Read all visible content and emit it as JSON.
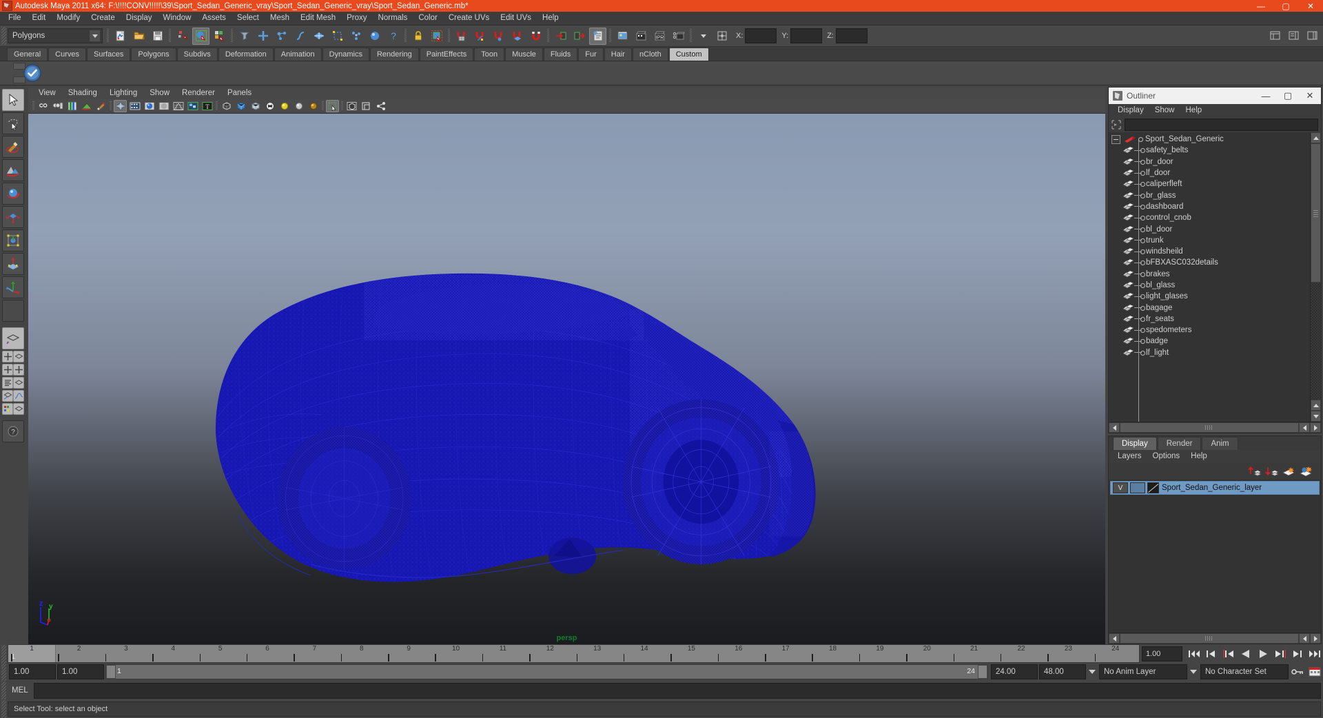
{
  "window": {
    "title": "Autodesk Maya 2011 x64: F:\\!!!!CONV!!!!!\\39\\Sport_Sedan_Generic_vray\\Sport_Sedan_Generic_vray\\Sport_Sedan_Generic.mb*",
    "minimize": "—",
    "maximize": "▢",
    "close": "✕",
    "accent_color": "#e8491d"
  },
  "menubar": {
    "items": [
      "File",
      "Edit",
      "Modify",
      "Create",
      "Display",
      "Window",
      "Assets",
      "Select",
      "Mesh",
      "Edit Mesh",
      "Proxy",
      "Normals",
      "Color",
      "Create UVs",
      "Edit UVs",
      "Help"
    ]
  },
  "statusline": {
    "menu_set": "Polygons",
    "coord_labels": {
      "x": "X:",
      "y": "Y:",
      "z": "Z:"
    },
    "coord_values": {
      "x": "",
      "y": "",
      "z": ""
    },
    "icons": [
      "new-scene-icon",
      "open-scene-icon",
      "save-scene-icon",
      "select-by-hierarchy-icon",
      "select-by-object-icon",
      "select-by-component-icon",
      "mask-filter-icon",
      "select-handles-icon",
      "select-joints-icon",
      "select-curves-icon",
      "select-surfaces-icon",
      "select-deformations-icon",
      "select-dynamics-icon",
      "select-rendering-icon",
      "select-misc-icon",
      "lock-icon",
      "marquee-select-icon",
      "snap-grid-icon",
      "snap-curve-icon",
      "snap-point-icon",
      "snap-view-plane-icon",
      "snap-magnet-icon",
      "input-connections-icon",
      "output-connections-icon",
      "attribute-editor-icon",
      "render-view-icon",
      "render-current-frame-icon",
      "ipr-render-icon",
      "render-settings-icon",
      "channel-box-toggle-icon"
    ]
  },
  "shelf": {
    "tabs": [
      "General",
      "Curves",
      "Surfaces",
      "Polygons",
      "Subdivs",
      "Deformation",
      "Animation",
      "Dynamics",
      "Rendering",
      "PaintEffects",
      "Toon",
      "Muscle",
      "Fluids",
      "Fur",
      "Hair",
      "nCloth",
      "Custom"
    ],
    "active_tab": "Custom",
    "items": [
      "vray-render-icon"
    ]
  },
  "toolbox": {
    "tools": [
      "select-tool",
      "lasso-select-tool",
      "paint-select-tool",
      "sculpt-geometry-tool",
      "rotate-tool",
      "scale-tool",
      "universal-manipulator-tool",
      "soft-modification-tool",
      "move-tool",
      "blank-slot"
    ],
    "layouts": [
      "single-perspective-layout",
      "four-view-layout-a",
      "four-view-layout-b",
      "outliner-persp-layout",
      "persp-graph-layout",
      "hypershade-persp-layout"
    ]
  },
  "viewport": {
    "menus": [
      "View",
      "Shading",
      "Lighting",
      "Show",
      "Renderer",
      "Panels"
    ],
    "camera_label": "persp",
    "toolbar_icons": [
      "select-camera-icon",
      "camera-attributes-icon",
      "bookmark-icon",
      "image-plane-icon",
      "paint-effects-icon",
      "two-d-pan-zoom-icon",
      "film-gate-icon",
      "resolution-gate-icon",
      "gate-mask-icon",
      "field-chart-icon",
      "safe-action-icon",
      "safe-title-icon",
      "wireframe-icon",
      "smooth-shade-all-icon",
      "smooth-shade-selected-icon",
      "flat-shade-icon",
      "shaded-textured-icon",
      "hardware-lighting-icon",
      "default-lighting-icon",
      "all-lights-icon",
      "shadows-icon",
      "isolate-select-icon",
      "xray-icon",
      "xray-joints-icon",
      "exposure-icon"
    ],
    "axis_gizmo": {
      "x_color": "#e02020",
      "y_color": "#20c020",
      "z_color": "#2020ff",
      "z_label": "z",
      "y_label": "y"
    },
    "model": {
      "name": "Sport_Sedan_Generic",
      "wire_color": "#1616b4",
      "shape": "sport-sedan-wireframe"
    }
  },
  "outliner": {
    "title": "Outliner",
    "window_icon": "maya-app-icon",
    "menus": [
      "Display",
      "Show",
      "Help"
    ],
    "search_value": "",
    "root": {
      "label": "Sport_Sedan_Generic",
      "expanded": true
    },
    "items": [
      "safety_belts",
      "br_door",
      "lf_door",
      "caliperfleft",
      "br_glass",
      "dashboard",
      "control_cnob",
      "bl_door",
      "trunk",
      "windsheild",
      "bFBXASC032details",
      "brakes",
      "bl_glass",
      "light_glases",
      "bagage",
      "fr_seats",
      "spedometers",
      "badge",
      "lf_light"
    ]
  },
  "layer_editor": {
    "tabs": [
      "Display",
      "Render",
      "Anim"
    ],
    "active_tab": "Display",
    "menus": [
      "Layers",
      "Options",
      "Help"
    ],
    "tool_icons": [
      "move-layer-up-icon",
      "move-layer-down-icon",
      "new-layer-icon",
      "new-layer-from-selected-icon"
    ],
    "layers": [
      {
        "name": "Sport_Sedan_Generic_layer",
        "visibility": "V",
        "display_type": "",
        "selected": true,
        "color": "#6e9ac4"
      }
    ]
  },
  "time_slider": {
    "ticks": [
      "1",
      "2",
      "3",
      "4",
      "5",
      "6",
      "7",
      "8",
      "9",
      "10",
      "11",
      "12",
      "13",
      "14",
      "15",
      "16",
      "17",
      "18",
      "19",
      "20",
      "21",
      "22",
      "23",
      "24"
    ],
    "current_frame": "1",
    "current_frame_field": "1.00",
    "playback_icons": [
      "go-to-start-icon",
      "step-back-keyframe-icon",
      "step-back-frame-icon",
      "play-backwards-icon",
      "play-forwards-icon",
      "step-forward-frame-icon",
      "step-forward-keyframe-icon",
      "go-to-end-icon"
    ]
  },
  "range_slider": {
    "anim_start": "1.00",
    "range_start": "1.00",
    "range_bar_start": "1",
    "range_bar_end": "24",
    "range_end": "24.00",
    "anim_end": "48.00",
    "anim_layer": "No Anim Layer",
    "character_set": "No Character Set",
    "icons": [
      "auto-key-icon",
      "animation-preferences-icon"
    ]
  },
  "command_line": {
    "label": "MEL",
    "value": "",
    "placeholder": ""
  },
  "help_line": {
    "message": "Select Tool: select an object"
  }
}
